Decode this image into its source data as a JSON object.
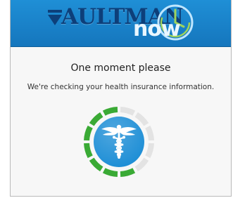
{
  "brand": {
    "word": "AULTMAN",
    "suffix": "now",
    "primary_color": "#1a84cc",
    "wordmark_color": "#0d3f7a",
    "accent_green": "#3aaa35"
  },
  "loading": {
    "title": "One moment please",
    "message": "We're checking your health insurance information.",
    "icon": "caduceus-icon",
    "progress_segments_complete": 7,
    "progress_segments_total": 12
  }
}
